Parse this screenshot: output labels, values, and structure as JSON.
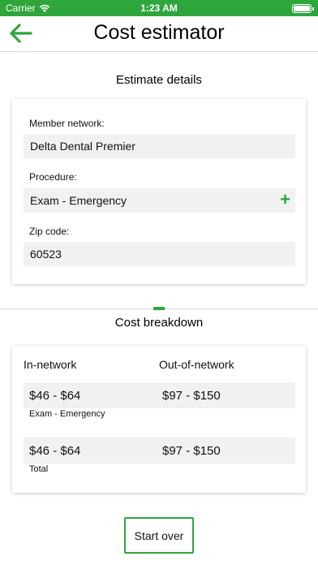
{
  "status_bar": {
    "carrier": "Carrier",
    "time": "1:23 AM"
  },
  "colors": {
    "accent": "#2ea63b",
    "field_bg": "#f1f1f1"
  },
  "nav": {
    "title": "Cost estimator",
    "back_icon": "arrow-left-icon"
  },
  "estimate": {
    "section_title": "Estimate details",
    "network_label": "Member network:",
    "network_value": "Delta Dental Premier",
    "procedure_label": "Procedure:",
    "procedure_value": "Exam - Emergency",
    "add_icon": "plus-icon",
    "zip_label": "Zip code:",
    "zip_value": "60523"
  },
  "breakdown": {
    "section_title": "Cost breakdown",
    "col_in": "In-network",
    "col_out": "Out-of-network",
    "rows": [
      {
        "in": "$46 - $64",
        "out": "$97 - $150",
        "label": "Exam - Emergency"
      },
      {
        "in": "$46 - $64",
        "out": "$97 - $150",
        "label": "Total"
      }
    ]
  },
  "actions": {
    "start_over": "Start over"
  }
}
